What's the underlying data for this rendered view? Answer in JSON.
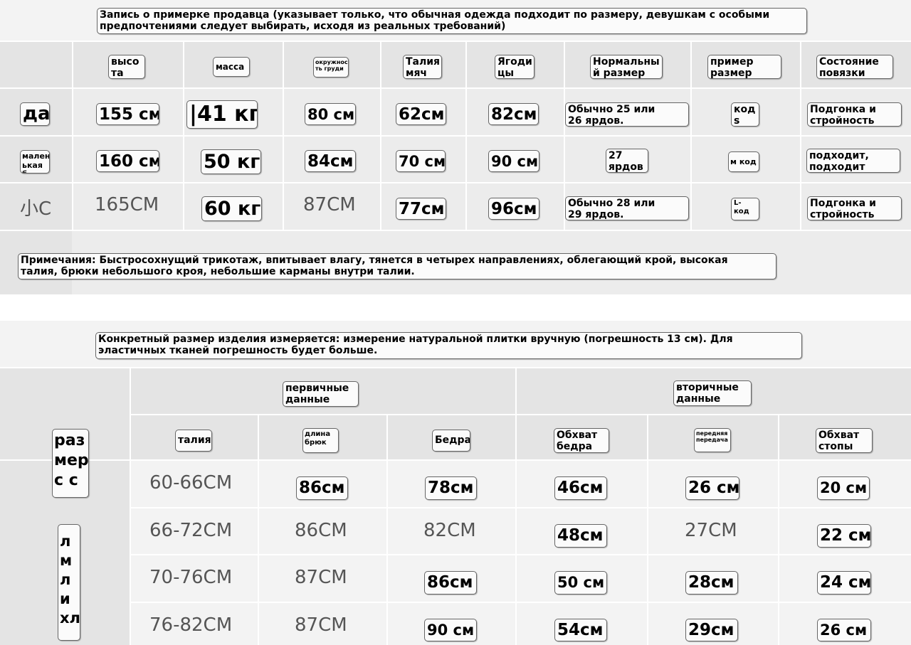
{
  "fitting": {
    "header": "Запись о примерке продавца (указывает только, что обычная одежда подходит по размеру, девушкам с особыми\nпредпочтениями следует выбирать, исходя из реальных требований)",
    "columns": [
      "высо\nта",
      "масса",
      "окружнос\nть груди",
      "Талия\nмяч",
      "Ягоди\nцы",
      "Нормальны\nй размер",
      "пример\nразмер",
      "Состояние\nповязки"
    ],
    "rows": [
      {
        "label": "да",
        "height": "155 см",
        "weight": "|41 кг",
        "chest": "80 см",
        "waist": "62см",
        "hips": "82см",
        "normal": "Обычно 25 или\n26 ярдов.",
        "trial": "код\ns",
        "state": "Подгонка и\nстройность"
      },
      {
        "label": "мален\nькая б",
        "height": "160 см",
        "weight": "50 кг",
        "chest": "84см",
        "waist": "70 см",
        "hips": "90 см",
        "normal": "27\nярдов",
        "trial": "м код",
        "state": "подходит,\nподходит"
      },
      {
        "label": "小C",
        "height": "165CM",
        "weight": "60 кг",
        "chest": "87CM",
        "waist": "77см",
        "hips": "96см",
        "normal": "Обычно 28 или\n29 ярдов.",
        "trial": "L-\nкод",
        "state": "Подгонка и\nстройность"
      }
    ],
    "notes": "Примечания: Быстросохнущий трикотаж, впитывает влагу, тянется в четырех направлениях, облегающий крой, высокая\nталия, брюки небольшого кроя, небольшие карманы внутри талии."
  },
  "measure": {
    "header": "Конкретный размер изделия измеряется: измерение натуральной плитки вручную (погрешность 13 см). Для\nэластичных тканей погрешность будет больше.",
    "primary": "первичные\nданные",
    "secondary": "вторичные\nданные",
    "size_label": "раз\nмер\nс с",
    "sizes_label": "л\nм\nл\nи\nхл",
    "columns": [
      "талия",
      "длина\nбрюк",
      "Бедра",
      "Обхват\nбедра",
      "передняя\nпередача",
      "Обхват\nстопы"
    ],
    "rows": [
      {
        "waist": "60-66CM",
        "length": "86см",
        "hips": "78см",
        "thigh": "46см",
        "rise": "26 см",
        "foot": "20 см"
      },
      {
        "waist": "66-72CM",
        "length": "86CM",
        "hips": "82CM",
        "thigh": "48см",
        "rise": "27CM",
        "foot": "22 см"
      },
      {
        "waist": "70-76CM",
        "length": "87CM",
        "hips": "86см",
        "thigh": "50 см",
        "rise": "28см",
        "foot": "24 см"
      },
      {
        "waist": "76-82CM",
        "length": "87CM",
        "hips": "90 см",
        "thigh": "54см",
        "rise": "29см",
        "foot": "26 см"
      }
    ]
  }
}
